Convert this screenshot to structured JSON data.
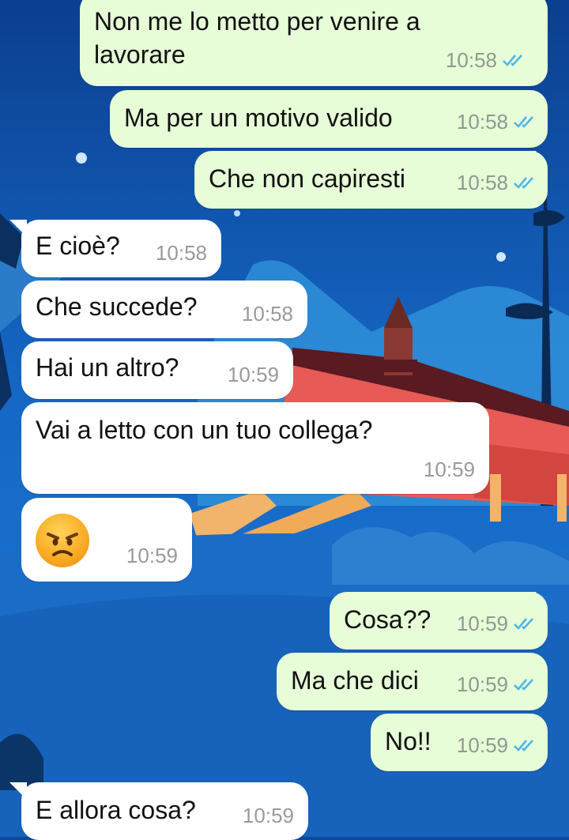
{
  "messages": [
    {
      "id": 1,
      "direction": "out",
      "text_line1": "Non me lo metto per venire a",
      "text_line2": "lavorare",
      "time": "10:58",
      "status": "read"
    },
    {
      "id": 2,
      "direction": "out",
      "text": "Ma per un motivo valido",
      "time": "10:58",
      "status": "read"
    },
    {
      "id": 3,
      "direction": "out",
      "text": "Che non capiresti",
      "time": "10:58",
      "status": "read"
    },
    {
      "id": 4,
      "direction": "in",
      "text": "E cioè?",
      "time": "10:58"
    },
    {
      "id": 5,
      "direction": "in",
      "text": "Che succede?",
      "time": "10:58"
    },
    {
      "id": 6,
      "direction": "in",
      "text": "Hai un altro?",
      "time": "10:59"
    },
    {
      "id": 7,
      "direction": "in",
      "text": "Vai a letto con un tuo collega?",
      "time": "10:59"
    },
    {
      "id": 8,
      "direction": "in",
      "emoji": "pouting-face",
      "time": "10:59"
    },
    {
      "id": 9,
      "direction": "out",
      "text": "Cosa??",
      "time": "10:59",
      "status": "read"
    },
    {
      "id": 10,
      "direction": "out",
      "text": "Ma che dici",
      "time": "10:59",
      "status": "read"
    },
    {
      "id": 11,
      "direction": "out",
      "text": "No!!",
      "time": "10:59",
      "status": "read"
    },
    {
      "id": 12,
      "direction": "in",
      "text": "E allora cosa?",
      "time": "10:59"
    }
  ],
  "colors": {
    "outgoing_bubble": "#e6fdd7",
    "incoming_bubble": "#ffffff",
    "read_ticks": "#4fb6ec",
    "wallpaper_sky": "#1566c4"
  },
  "icons": {
    "read_status": "double-check-icon",
    "emoji": "angry-face-icon"
  }
}
